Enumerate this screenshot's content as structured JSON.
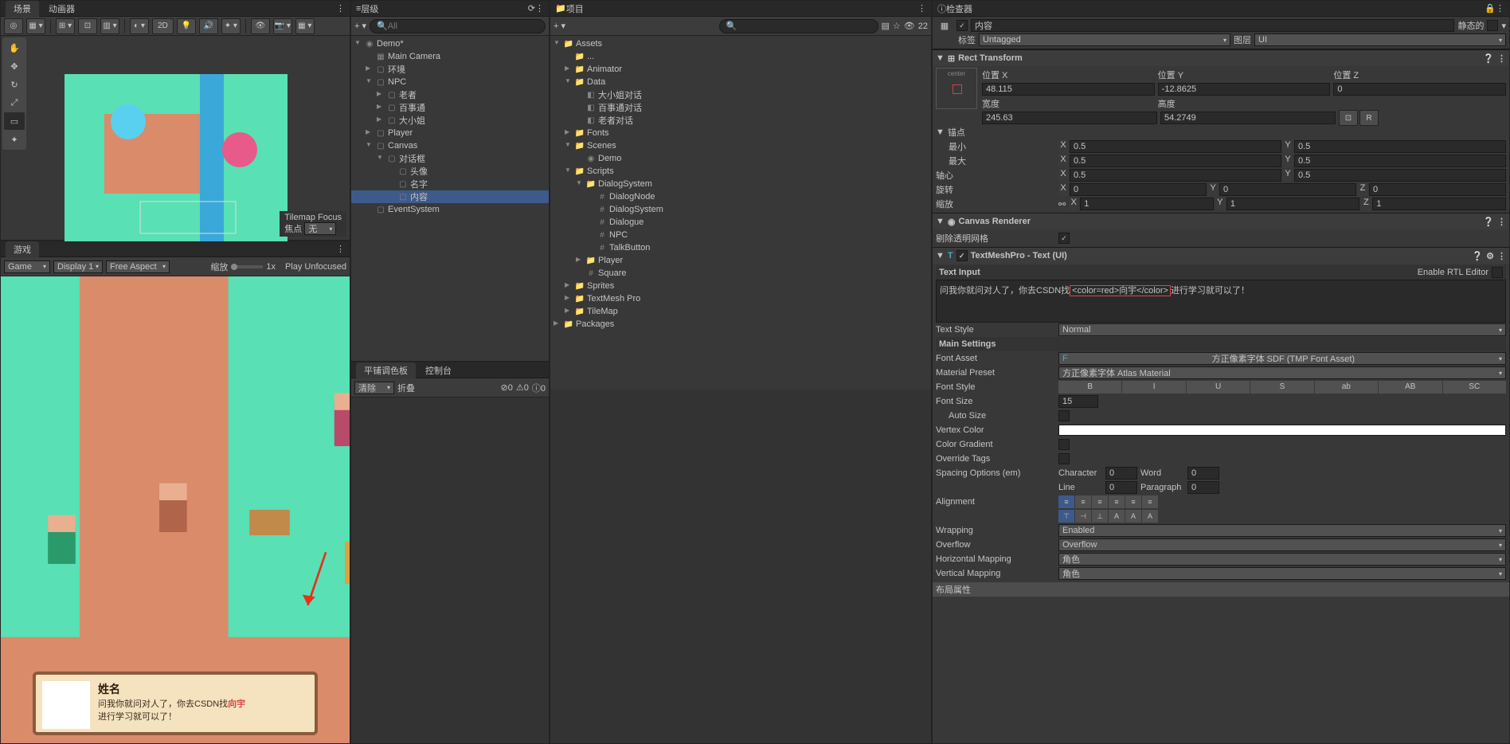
{
  "scene": {
    "tab": "场景",
    "animator_tab": "动画器",
    "btn_2d": "2D",
    "tilemap_focus": "Tilemap Focus",
    "focus_label": "焦点",
    "focus_value": "无"
  },
  "game": {
    "tab": "游戏",
    "game_mode": "Game",
    "display": "Display 1",
    "aspect": "Free Aspect",
    "scale_label": "缩放",
    "scale_value": "1x",
    "play_unfocused": "Play Unfocused",
    "dialog_name": "姓名",
    "dialog_line1": "问我你就问对人了，你去CSDN找",
    "dialog_highlight": "向宇",
    "dialog_line2": "进行学习就可以了！"
  },
  "hierarchy": {
    "title": "层级",
    "search_placeholder": "All",
    "items": [
      {
        "depth": 0,
        "arrow": "▼",
        "icon": "◉",
        "label": "Demo*"
      },
      {
        "depth": 1,
        "arrow": "",
        "icon": "▦",
        "label": "Main Camera"
      },
      {
        "depth": 1,
        "arrow": "▶",
        "icon": "▢",
        "label": "环境"
      },
      {
        "depth": 1,
        "arrow": "▼",
        "icon": "▢",
        "label": "NPC"
      },
      {
        "depth": 2,
        "arrow": "▶",
        "icon": "▢",
        "label": "老者"
      },
      {
        "depth": 2,
        "arrow": "▶",
        "icon": "▢",
        "label": "百事通"
      },
      {
        "depth": 2,
        "arrow": "▶",
        "icon": "▢",
        "label": "大小姐"
      },
      {
        "depth": 1,
        "arrow": "▶",
        "icon": "▢",
        "label": "Player"
      },
      {
        "depth": 1,
        "arrow": "▼",
        "icon": "▢",
        "label": "Canvas"
      },
      {
        "depth": 2,
        "arrow": "▼",
        "icon": "▢",
        "label": "对话框"
      },
      {
        "depth": 3,
        "arrow": "",
        "icon": "▢",
        "label": "头像"
      },
      {
        "depth": 3,
        "arrow": "",
        "icon": "▢",
        "label": "名字"
      },
      {
        "depth": 3,
        "arrow": "",
        "icon": "▢",
        "label": "内容",
        "selected": true
      },
      {
        "depth": 1,
        "arrow": "",
        "icon": "▢",
        "label": "EventSystem"
      }
    ]
  },
  "project": {
    "title": "项目",
    "visibility_count": "22",
    "items": [
      {
        "depth": 0,
        "arrow": "▼",
        "icon": "📁",
        "label": "Assets"
      },
      {
        "depth": 1,
        "arrow": "",
        "icon": "📁",
        "label": "..."
      },
      {
        "depth": 1,
        "arrow": "▶",
        "icon": "📁",
        "label": "Animator"
      },
      {
        "depth": 1,
        "arrow": "▼",
        "icon": "📁",
        "label": "Data"
      },
      {
        "depth": 2,
        "arrow": "",
        "icon": "◧",
        "label": "大小姐对话"
      },
      {
        "depth": 2,
        "arrow": "",
        "icon": "◧",
        "label": "百事通对话"
      },
      {
        "depth": 2,
        "arrow": "",
        "icon": "◧",
        "label": "老者对话"
      },
      {
        "depth": 1,
        "arrow": "▶",
        "icon": "📁",
        "label": "Fonts"
      },
      {
        "depth": 1,
        "arrow": "▼",
        "icon": "📁",
        "label": "Scenes"
      },
      {
        "depth": 2,
        "arrow": "",
        "icon": "◉",
        "label": "Demo"
      },
      {
        "depth": 1,
        "arrow": "▼",
        "icon": "📁",
        "label": "Scripts"
      },
      {
        "depth": 2,
        "arrow": "▼",
        "icon": "📁",
        "label": "DialogSystem"
      },
      {
        "depth": 3,
        "arrow": "",
        "icon": "#",
        "label": "DialogNode"
      },
      {
        "depth": 3,
        "arrow": "",
        "icon": "#",
        "label": "DialogSystem"
      },
      {
        "depth": 3,
        "arrow": "",
        "icon": "#",
        "label": "Dialogue"
      },
      {
        "depth": 3,
        "arrow": "",
        "icon": "#",
        "label": "NPC"
      },
      {
        "depth": 3,
        "arrow": "",
        "icon": "#",
        "label": "TalkButton"
      },
      {
        "depth": 2,
        "arrow": "▶",
        "icon": "📁",
        "label": "Player"
      },
      {
        "depth": 2,
        "arrow": "",
        "icon": "#",
        "label": "Square"
      },
      {
        "depth": 1,
        "arrow": "▶",
        "icon": "📁",
        "label": "Sprites"
      },
      {
        "depth": 1,
        "arrow": "▶",
        "icon": "📁",
        "label": "TextMesh Pro"
      },
      {
        "depth": 1,
        "arrow": "▶",
        "icon": "📁",
        "label": "TileMap"
      },
      {
        "depth": 0,
        "arrow": "▶",
        "icon": "📁",
        "label": "Packages"
      }
    ]
  },
  "tile": {
    "tab1": "平铺调色板",
    "tab2": "控制台",
    "clear": "清除",
    "collapse": "折叠",
    "err": "0",
    "warn": "0",
    "info": "0"
  },
  "inspector": {
    "title": "检查器",
    "go_name": "内容",
    "static": "静态的",
    "tag_label": "标签",
    "tag": "Untagged",
    "layer_label": "图层",
    "layer": "UI",
    "rect": {
      "title": "Rect Transform",
      "anchor_preset": "center",
      "pos_x_label": "位置 X",
      "pos_x": "48.115",
      "pos_y_label": "位置 Y",
      "pos_y": "-12.8625",
      "pos_z_label": "位置 Z",
      "pos_z": "0",
      "width_label": "宽度",
      "width": "245.63",
      "height_label": "高度",
      "height": "54.2749",
      "anchors_label": "锚点",
      "min_label": "最小",
      "min_x": "0.5",
      "min_y": "0.5",
      "max_label": "最大",
      "max_x": "0.5",
      "max_y": "0.5",
      "pivot_label": "轴心",
      "pivot_x": "0.5",
      "pivot_y": "0.5",
      "rotation_label": "旋转",
      "rot_x": "0",
      "rot_y": "0",
      "rot_z": "0",
      "scale_label": "缩放",
      "scale_x": "1",
      "scale_y": "1",
      "scale_z": "1",
      "r_btn": "R"
    },
    "canvas_renderer": {
      "title": "Canvas Renderer",
      "cull_label": "剔除透明网格"
    },
    "tmp": {
      "title": "TextMeshPro - Text (UI)",
      "text_input_label": "Text Input",
      "rtl_label": "Enable RTL Editor",
      "text_before": "问我你就问对人了，你去CSDN找",
      "text_tag": "<color=red>向宇</color>",
      "text_after": "进行学习就可以了！",
      "text_style_label": "Text Style",
      "text_style": "Normal",
      "main_settings": "Main Settings",
      "font_asset_label": "Font Asset",
      "font_asset": "方正像素字体 SDF (TMP Font Asset)",
      "mat_preset_label": "Material Preset",
      "mat_preset": "方正像素字体 Atlas Material",
      "font_style_label": "Font Style",
      "fs": {
        "b": "B",
        "i": "I",
        "u": "U",
        "s": "S",
        "ab": "ab",
        "AB": "AB",
        "sc": "SC"
      },
      "font_size_label": "Font Size",
      "font_size": "15",
      "auto_size_label": "Auto Size",
      "vertex_color_label": "Vertex Color",
      "color_gradient_label": "Color Gradient",
      "override_tags_label": "Override Tags",
      "spacing_label": "Spacing Options (em)",
      "char_label": "Character",
      "char": "0",
      "word_label": "Word",
      "word": "0",
      "line_label": "Line",
      "line": "0",
      "para_label": "Paragraph",
      "para": "0",
      "alignment_label": "Alignment",
      "wrapping_label": "Wrapping",
      "wrapping": "Enabled",
      "overflow_label": "Overflow",
      "overflow": "Overflow",
      "hmap_label": "Horizontal Mapping",
      "hmap": "角色",
      "vmap_label": "Vertical Mapping",
      "vmap": "角色",
      "layout_props": "布局属性"
    }
  }
}
